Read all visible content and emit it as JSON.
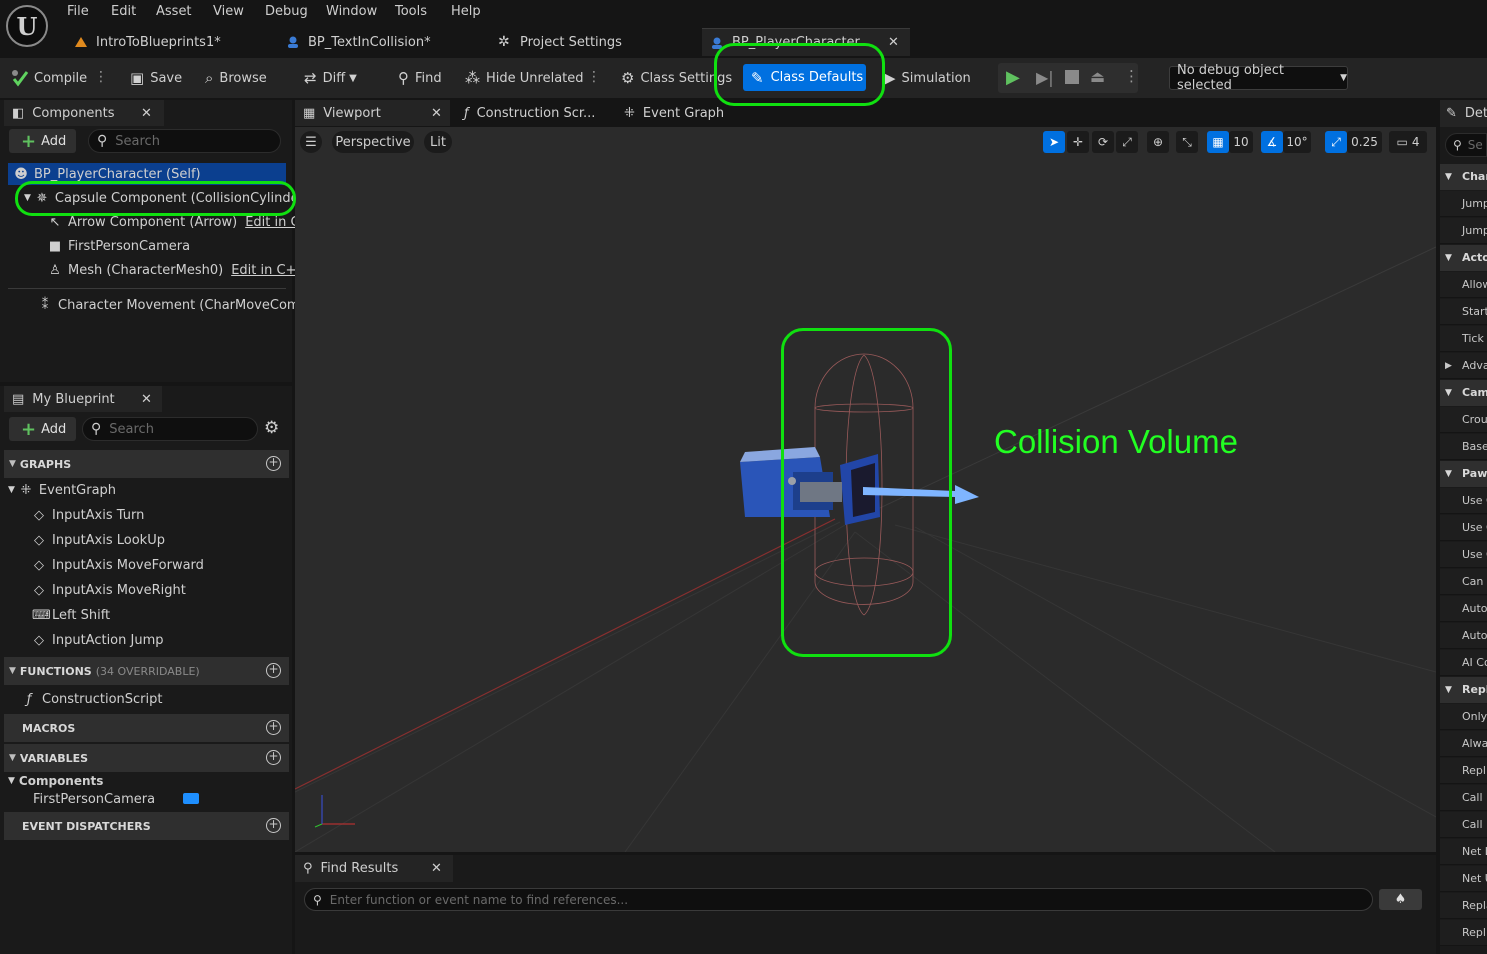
{
  "menu": [
    "File",
    "Edit",
    "Asset",
    "View",
    "Debug",
    "Window",
    "Tools",
    "Help"
  ],
  "logo_text": "U",
  "doc_tabs": [
    {
      "label": "IntroToBlueprints1*",
      "icon": "map-icon"
    },
    {
      "label": "BP_TextInCollision*",
      "icon": "blueprint-icon"
    },
    {
      "label": "Project Settings",
      "icon": "settings-icon"
    },
    {
      "label": "BP_PlayerCharacter",
      "icon": "blueprint-icon",
      "active": true
    }
  ],
  "toolbar": {
    "compile": "Compile",
    "save": "Save",
    "browse": "Browse",
    "diff": "Diff",
    "find": "Find",
    "hide_unrelated": "Hide Unrelated",
    "class_settings": "Class Settings",
    "class_defaults": "Class Defaults",
    "simulation": "Simulation",
    "debug_object": "No debug object selected"
  },
  "components_panel": {
    "title": "Components",
    "add": "Add",
    "search_placeholder": "Search",
    "items": [
      {
        "label": "BP_PlayerCharacter (Self)"
      },
      {
        "label": "Capsule Component (CollisionCylinder)"
      },
      {
        "label": "Arrow Component (Arrow)",
        "edit": "Edit in C++"
      },
      {
        "label": "FirstPersonCamera"
      },
      {
        "label": "Mesh (CharacterMesh0)",
        "edit": "Edit in C++"
      },
      {
        "label": "Character Movement (CharMoveComp)"
      }
    ]
  },
  "my_blueprint": {
    "title": "My Blueprint",
    "add": "Add",
    "search_placeholder": "Search",
    "graphs_header": "GRAPHS",
    "event_graph": "EventGraph",
    "events": [
      "InputAxis Turn",
      "InputAxis LookUp",
      "InputAxis MoveForward",
      "InputAxis MoveRight",
      "Left Shift",
      "InputAction Jump"
    ],
    "functions_header": "FUNCTIONS",
    "functions_sub": "(34 OVERRIDABLE)",
    "construction_script": "ConstructionScript",
    "macros_header": "MACROS",
    "variables_header": "VARIABLES",
    "components_group": "Components",
    "component_var": "FirstPersonCamera",
    "dispatchers_header": "EVENT DISPATCHERS"
  },
  "editor_tabs": {
    "viewport": "Viewport",
    "construction": "Construction Scr...",
    "event_graph": "Event Graph"
  },
  "viewport": {
    "perspective": "Perspective",
    "lit": "Lit",
    "grid_snap": "10",
    "rot_snap": "10°",
    "scale_snap": "0.25",
    "camera_speed": "4"
  },
  "annotation": "Collision Volume",
  "details": {
    "title": "Det",
    "search_placeholder": "Se",
    "rows": [
      {
        "label": "Chara",
        "cat": true
      },
      {
        "label": "Jump"
      },
      {
        "label": "Jump"
      },
      {
        "label": "Actor",
        "cat": true
      },
      {
        "label": "Allow"
      },
      {
        "label": "Start"
      },
      {
        "label": "Tick"
      },
      {
        "label": "Adva",
        "collapsed": true
      },
      {
        "label": "Came",
        "cat": true
      },
      {
        "label": "Crou"
      },
      {
        "label": "Base"
      },
      {
        "label": "Pawn",
        "cat": true
      },
      {
        "label": "Use C"
      },
      {
        "label": "Use C"
      },
      {
        "label": "Use C"
      },
      {
        "label": "Can A"
      },
      {
        "label": "Auto"
      },
      {
        "label": "Auto"
      },
      {
        "label": "AI Co"
      },
      {
        "label": "Repli",
        "cat": true
      },
      {
        "label": "Only"
      },
      {
        "label": "Alwa"
      },
      {
        "label": "Repli"
      },
      {
        "label": "Call R"
      },
      {
        "label": "Call R"
      },
      {
        "label": "Net L"
      },
      {
        "label": "Net U"
      },
      {
        "label": "Repla"
      },
      {
        "label": "Repli"
      }
    ]
  },
  "find_results": {
    "title": "Find Results",
    "placeholder": "Enter function or event name to find references..."
  },
  "colors": {
    "accent": "#0070e0",
    "highlight": "#10e010",
    "bg": "#151515"
  }
}
